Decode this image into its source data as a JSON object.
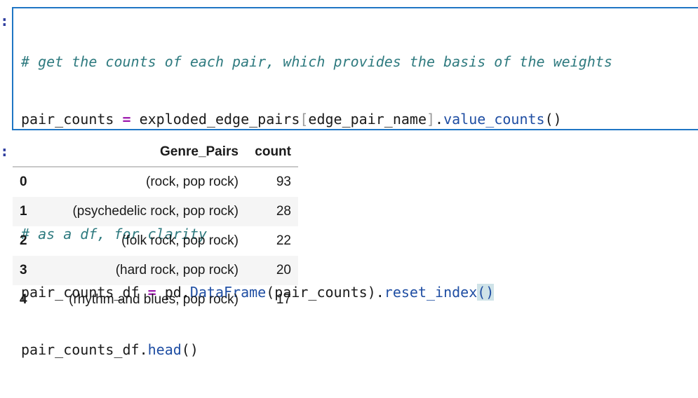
{
  "input_prompt": ":",
  "output_prompt": ":",
  "code": {
    "line1_comment": "# get the counts of each pair, which provides the basis of the weights",
    "line2": {
      "var": "pair_counts ",
      "op": "=",
      "obj": " exploded_edge_pairs",
      "lbr": "[",
      "key": "edge_pair_name",
      "rbr": "]",
      "dot": ".",
      "fn": "value_counts",
      "paren": "()"
    },
    "line4_comment": "# as a df, for clarity",
    "line5": {
      "var": "pair_counts_df ",
      "op": "=",
      "mod": " pd.",
      "cls": "DataFrame",
      "args": "(pair_counts).",
      "fn": "reset_index",
      "paren": "()"
    },
    "line6": {
      "var": "pair_counts_df.",
      "fn": "head",
      "paren": "()"
    }
  },
  "table": {
    "columns": [
      "",
      "Genre_Pairs",
      "count"
    ],
    "rows": [
      {
        "index": "0",
        "pair": "(rock, pop rock)",
        "count": "93"
      },
      {
        "index": "1",
        "pair": "(psychedelic rock, pop rock)",
        "count": "28"
      },
      {
        "index": "2",
        "pair": "(folk rock, pop rock)",
        "count": "22"
      },
      {
        "index": "3",
        "pair": "(hard rock, pop rock)",
        "count": "20"
      },
      {
        "index": "4",
        "pair": "(rhythm and blues, pop rock)",
        "count": "17"
      }
    ]
  }
}
